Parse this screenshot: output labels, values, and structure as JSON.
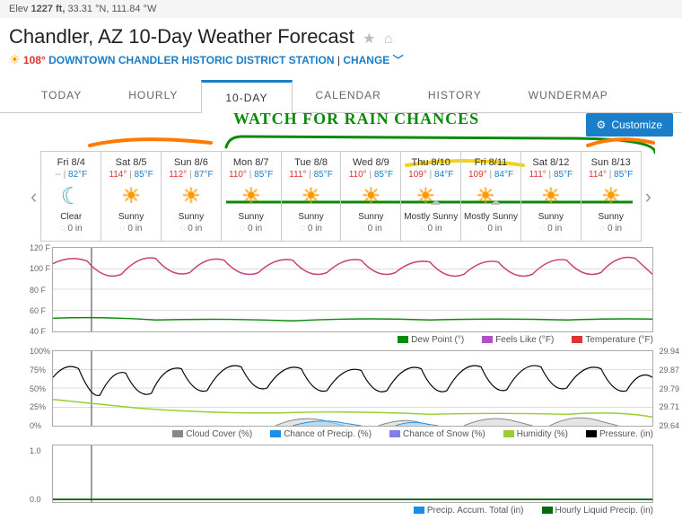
{
  "header": {
    "elev_label": "Elev",
    "elev_value": "1227 ft,",
    "coords": "33.31 °N, 111.84 °W",
    "page_title": "Chandler, AZ 10-Day Weather Forecast",
    "current_temp": "108°",
    "station": "DOWNTOWN CHANDLER HISTORIC DISTRICT STATION",
    "change_label": "CHANGE"
  },
  "tabs": {
    "today": "TODAY",
    "hourly": "HOURLY",
    "tenday": "10-DAY",
    "calendar": "CALENDAR",
    "history": "HISTORY",
    "wundermap": "WUNDERMAP"
  },
  "customize_label": "Customize",
  "annotation_text": "WATCH FOR RAIN CHANCES",
  "days": [
    {
      "date": "Fri 8/4",
      "hi": "--",
      "lo": "82°F",
      "icon": "moon",
      "cond": "Clear",
      "precip": "0 in"
    },
    {
      "date": "Sat 8/5",
      "hi": "114°",
      "lo": "85°F",
      "icon": "sun",
      "cond": "Sunny",
      "precip": "0 in"
    },
    {
      "date": "Sun 8/6",
      "hi": "112°",
      "lo": "87°F",
      "icon": "sun",
      "cond": "Sunny",
      "precip": "0 in"
    },
    {
      "date": "Mon 8/7",
      "hi": "110°",
      "lo": "85°F",
      "icon": "sun",
      "cond": "Sunny",
      "precip": "0 in"
    },
    {
      "date": "Tue 8/8",
      "hi": "111°",
      "lo": "85°F",
      "icon": "sun",
      "cond": "Sunny",
      "precip": "0 in"
    },
    {
      "date": "Wed 8/9",
      "hi": "110°",
      "lo": "85°F",
      "icon": "sun",
      "cond": "Sunny",
      "precip": "0 in"
    },
    {
      "date": "Thu 8/10",
      "hi": "109°",
      "lo": "84°F",
      "icon": "mostly",
      "cond": "Mostly Sunny",
      "precip": "0 in"
    },
    {
      "date": "Fri 8/11",
      "hi": "109°",
      "lo": "84°F",
      "icon": "mostly",
      "cond": "Mostly Sunny",
      "precip": "0 in"
    },
    {
      "date": "Sat 8/12",
      "hi": "111°",
      "lo": "85°F",
      "icon": "sun",
      "cond": "Sunny",
      "precip": "0 in"
    },
    {
      "date": "Sun 8/13",
      "hi": "114°",
      "lo": "85°F",
      "icon": "sun",
      "cond": "Sunny",
      "precip": "0 in"
    }
  ],
  "chart1": {
    "yticks": [
      "120 F",
      "100 F",
      "80 F",
      "60 F",
      "40 F"
    ],
    "legend": [
      {
        "color": "#0a8a0a",
        "label": "Dew Point (°)"
      },
      {
        "color": "#b050c8",
        "label": "Feels Like (°F)"
      },
      {
        "color": "#d33",
        "label": "Temperature (°F)"
      }
    ]
  },
  "chart2": {
    "yticks": [
      "100%",
      "75%",
      "50%",
      "25%",
      "0%"
    ],
    "yticks_r": [
      "29.94",
      "29.87",
      "29.79",
      "29.71",
      "29.64"
    ],
    "legend": [
      {
        "color": "#888",
        "label": "Cloud Cover (%)"
      },
      {
        "color": "#1a8ee8",
        "label": "Chance of Precip. (%)"
      },
      {
        "color": "#8080e8",
        "label": "Chance of Snow (%)"
      },
      {
        "color": "#9acd32",
        "label": "Humidity (%)"
      },
      {
        "color": "#000",
        "label": "Pressure. (in)"
      }
    ]
  },
  "chart3": {
    "yticks": [
      "1.0",
      "0.0"
    ],
    "legend": [
      {
        "color": "#1a8ee8",
        "label": "Precip. Accum. Total (in)"
      },
      {
        "color": "#0a6a0a",
        "label": "Hourly Liquid Precip. (in)"
      }
    ]
  },
  "chart_data": {
    "type": "line",
    "panels": [
      {
        "ylim": [
          40,
          120
        ],
        "series": [
          {
            "name": "Temperature (°F)",
            "pattern": "daily oscillation",
            "highs": [
              108,
              114,
              112,
              110,
              111,
              110,
              109,
              109,
              111,
              114
            ],
            "lows": [
              82,
              85,
              87,
              85,
              85,
              85,
              84,
              84,
              85,
              85
            ]
          },
          {
            "name": "Feels Like (°F)",
            "note": "closely follows Temperature"
          },
          {
            "name": "Dew Point (°)",
            "approx_range": [
              45,
              55
            ]
          }
        ]
      },
      {
        "ylim_left_pct": [
          0,
          100
        ],
        "ylim_right_in": [
          29.64,
          29.94
        ],
        "series": [
          {
            "name": "Pressure (in)",
            "approx_range": [
              29.66,
              29.9
            ],
            "pattern": "daily oscillation"
          },
          {
            "name": "Humidity (%)",
            "approx_range": [
              10,
              35
            ]
          },
          {
            "name": "Cloud Cover (%)",
            "note": "small peaks 8/8–8/12"
          },
          {
            "name": "Chance of Precip (%)",
            "note": "small peaks 8/8–8/10",
            "max_pct": 20
          },
          {
            "name": "Chance of Snow (%)",
            "value": 0
          }
        ]
      },
      {
        "ylim": [
          0,
          1.0
        ],
        "series": [
          {
            "name": "Precip Accum Total (in)",
            "value": 0
          },
          {
            "name": "Hourly Liquid Precip (in)",
            "value": 0
          }
        ]
      }
    ]
  }
}
